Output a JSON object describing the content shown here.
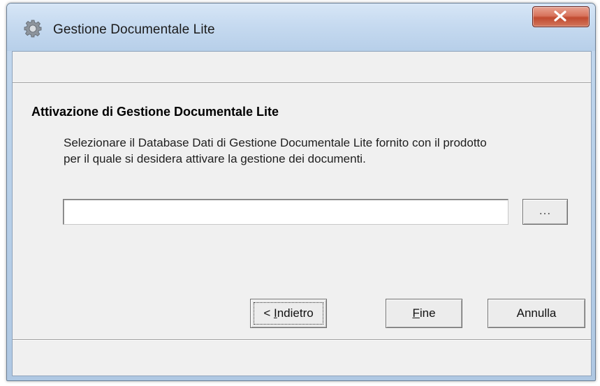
{
  "window": {
    "title": "Gestione Documentale Lite",
    "icon": "gear-icon",
    "close_icon": "close-icon"
  },
  "main": {
    "section_title": "Attivazione di Gestione Documentale Lite",
    "description_line1": "Selezionare il Database Dati di Gestione Documentale Lite fornito con il prodotto",
    "description_line2": "per il quale si desidera attivare la gestione dei documenti.",
    "path_value": "",
    "browse_label": "..."
  },
  "buttons": {
    "back_prefix": "< ",
    "back_mnemonic": "I",
    "back_rest": "ndietro",
    "finish_mnemonic": "F",
    "finish_rest": "ine",
    "cancel_label": "Annulla"
  },
  "colors": {
    "title_bar": "#c6daf0",
    "close_button": "#c8553d",
    "client_bg": "#f0f0f0"
  }
}
